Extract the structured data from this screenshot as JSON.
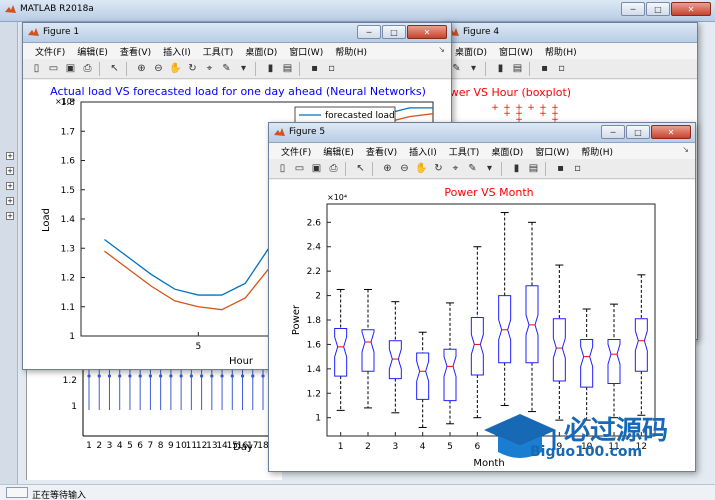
{
  "main_window": {
    "title": "MATLAB R2018a",
    "status": "正在等待输入"
  },
  "menus": [
    "文件(F)",
    "编辑(E)",
    "查看(V)",
    "插入(I)",
    "工具(T)",
    "桌面(D)",
    "窗口(W)",
    "帮助(H)"
  ],
  "window_buttons": {
    "minimize": "─",
    "maximize": "□",
    "close": "✕"
  },
  "toolbar_icons": [
    "new-file-icon",
    "open-folder-icon",
    "save-icon",
    "print-icon",
    "pointer-icon",
    "zoom-in-icon",
    "zoom-out-icon",
    "pan-icon",
    "rotate-3d-icon",
    "data-cursor-icon",
    "brush-icon",
    "link-icon",
    "colorbar-icon",
    "legend-icon",
    "hide-plot-tools-icon",
    "show-plot-tools-icon"
  ],
  "figure4": {
    "title": "Figure 4",
    "plot_title": "ower VS Hour (boxplot)"
  },
  "figure_bottom": {
    "xlabel": "Day",
    "ytick_labels": [
      "1.2",
      "1"
    ],
    "xtick_labels": [
      "1",
      "2",
      "3",
      "4",
      "5",
      "6",
      "7",
      "8",
      "9",
      "10",
      "11",
      "12",
      "13",
      "14",
      "15",
      "16",
      "17",
      "18",
      "19"
    ]
  },
  "figure1": {
    "title": "Figure 1",
    "chart_data": {
      "type": "line",
      "title": "Actual load VS forecasted load for one day ahead (Neural Networks)",
      "xlabel": "Hour",
      "ylabel": "Load",
      "ylim": [
        1,
        1.8
      ],
      "xlim": [
        0,
        15
      ],
      "exponent": "×10⁴",
      "yticks": [
        "1",
        "1.1",
        "1.2",
        "1.3",
        "1.4",
        "1.5",
        "1.6",
        "1.7",
        "1.8"
      ],
      "xticks": [
        "5",
        "10"
      ],
      "legend": [
        "forecasted load"
      ],
      "series": [
        {
          "name": "forecasted load",
          "color": "#0072bd",
          "x": [
            1,
            2,
            3,
            4,
            5,
            6,
            7,
            8,
            9,
            10,
            11,
            12,
            13,
            14,
            15
          ],
          "values": [
            1.33,
            1.27,
            1.21,
            1.16,
            1.14,
            1.14,
            1.18,
            1.3,
            1.46,
            1.6,
            1.68,
            1.73,
            1.76,
            1.78,
            1.78
          ]
        },
        {
          "name": "",
          "color": "#d95319",
          "x": [
            1,
            2,
            3,
            4,
            5,
            6,
            7,
            8,
            9,
            10,
            11,
            12,
            13,
            14,
            15
          ],
          "values": [
            1.29,
            1.23,
            1.17,
            1.12,
            1.1,
            1.09,
            1.13,
            1.23,
            1.4,
            1.54,
            1.64,
            1.7,
            1.73,
            1.75,
            1.76
          ]
        }
      ]
    }
  },
  "figure5": {
    "title": "Figure 5",
    "chart_data": {
      "type": "boxplot",
      "title": "Power VS Month",
      "xlabel": "Month",
      "ylabel": "Power",
      "exponent": "×10⁴",
      "ylim": [
        0.85,
        2.75
      ],
      "yticks": [
        "1",
        "1.2",
        "1.4",
        "1.6",
        "1.8",
        "2",
        "2.2",
        "2.4",
        "2.6"
      ],
      "categories": [
        "1",
        "2",
        "3",
        "4",
        "5",
        "6",
        "7",
        "8",
        "9",
        "10",
        "11",
        "12"
      ],
      "boxes": [
        {
          "min": 1.06,
          "q1": 1.34,
          "median": 1.58,
          "q3": 1.73,
          "max": 2.05
        },
        {
          "min": 1.08,
          "q1": 1.38,
          "median": 1.62,
          "q3": 1.72,
          "max": 2.05
        },
        {
          "min": 1.04,
          "q1": 1.32,
          "median": 1.48,
          "q3": 1.63,
          "max": 1.95
        },
        {
          "min": 0.92,
          "q1": 1.15,
          "median": 1.38,
          "q3": 1.53,
          "max": 1.7
        },
        {
          "min": 0.95,
          "q1": 1.14,
          "median": 1.42,
          "q3": 1.56,
          "max": 1.94
        },
        {
          "min": 1.0,
          "q1": 1.35,
          "median": 1.6,
          "q3": 1.82,
          "max": 2.4
        },
        {
          "min": 1.1,
          "q1": 1.45,
          "median": 1.72,
          "q3": 2.0,
          "max": 2.68
        },
        {
          "min": 1.05,
          "q1": 1.45,
          "median": 1.76,
          "q3": 2.08,
          "max": 2.6
        },
        {
          "min": 0.98,
          "q1": 1.3,
          "median": 1.57,
          "q3": 1.81,
          "max": 2.25
        },
        {
          "min": 0.98,
          "q1": 1.25,
          "median": 1.5,
          "q3": 1.64,
          "max": 1.89
        },
        {
          "min": 1.0,
          "q1": 1.28,
          "median": 1.52,
          "q3": 1.64,
          "max": 1.93
        },
        {
          "min": 1.02,
          "q1": 1.38,
          "median": 1.63,
          "q3": 1.81,
          "max": 2.17
        }
      ]
    }
  },
  "watermark": {
    "text_cn": "必过源码",
    "text_en": "Biguo100.com"
  },
  "colors": {
    "axis_blue": "#0000ff",
    "title_red": "#ff0000",
    "box_blue": "#2020ff",
    "whisker": "#000000"
  }
}
